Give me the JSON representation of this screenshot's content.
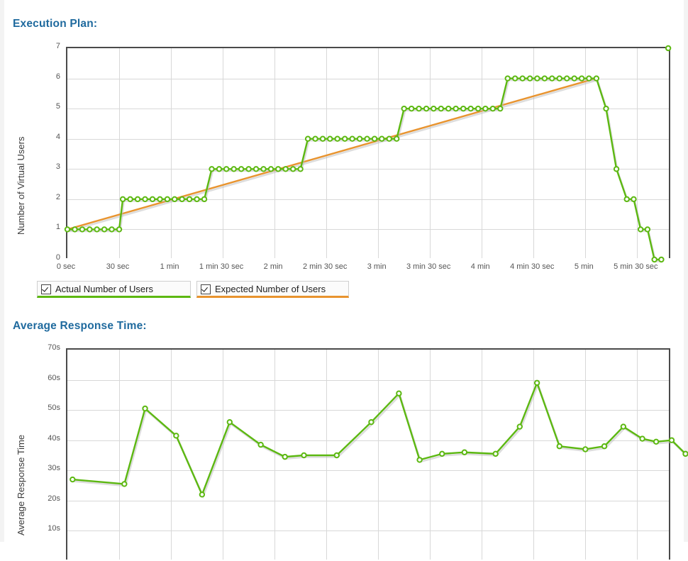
{
  "page": {
    "background": "#ffffff",
    "accent_title_color": "#1f6a9e",
    "series_green": "#5cb811",
    "series_orange": "#e8932e",
    "axis_color": "#4a4a4a",
    "grid_color": "#d8d8d8"
  },
  "execution_plan": {
    "title": "Execution Plan:",
    "legend": [
      {
        "label": "Actual Number of Users",
        "checked": true,
        "color": "#5cb811"
      },
      {
        "label": "Expected Number of Users",
        "checked": true,
        "color": "#e8932e"
      }
    ]
  },
  "average_response": {
    "title": "Average Response Time:"
  },
  "chart_data": [
    {
      "id": "execution-plan",
      "type": "line",
      "title": "Execution Plan:",
      "xlabel": "",
      "ylabel": "Number of Virtual Users",
      "ylim": [
        0,
        7
      ],
      "yticks": [
        0,
        1,
        2,
        3,
        4,
        5,
        6,
        7
      ],
      "ytick_labels": [
        "0",
        "1",
        "2",
        "3",
        "4",
        "5",
        "6",
        "7"
      ],
      "xlim_seconds": [
        0,
        350
      ],
      "xticks_seconds": [
        0,
        30,
        60,
        90,
        120,
        150,
        180,
        210,
        240,
        270,
        300,
        330
      ],
      "xtick_labels": [
        "0 sec",
        "30 sec",
        "1 min",
        "1 min 30 sec",
        "2 min",
        "2 min 30 sec",
        "3 min",
        "3 min 30 sec",
        "4 min",
        "4 min 30 sec",
        "5 min",
        "5 min 30 sec"
      ],
      "grid": true,
      "legend_position": "below",
      "markers": "open-circle",
      "series": [
        {
          "name": "Actual Number of Users",
          "color": "#5cb811",
          "x": [
            0,
            4.3,
            8.6,
            12.9,
            17.1,
            21.4,
            25.7,
            30,
            32.1,
            36.4,
            40.7,
            45,
            49.3,
            53.6,
            57.9,
            62.1,
            66.4,
            70.7,
            75,
            79.3,
            83.6,
            87.9,
            92.1,
            96.4,
            100.7,
            105,
            109.3,
            113.6,
            117.9,
            122.1,
            126.4,
            130.7,
            135,
            139.3,
            143.6,
            147.9,
            152.1,
            156.4,
            160.7,
            165,
            169.3,
            173.6,
            177.9,
            182.1,
            186.4,
            190.7,
            195,
            199.3,
            203.6,
            207.9,
            212.1,
            216.4,
            220.7,
            225,
            229.3,
            233.6,
            237.9,
            242.1,
            246.4,
            250.7,
            255,
            259.3,
            263.6,
            267.9,
            272.1,
            276.4,
            280.7,
            285,
            289.3,
            293.6,
            297.9,
            302.1,
            306.4,
            312,
            318,
            324,
            328,
            332,
            336,
            340,
            344,
            348
          ],
          "y": [
            1,
            1,
            1,
            1,
            1,
            1,
            1,
            1,
            2,
            2,
            2,
            2,
            2,
            2,
            2,
            2,
            2,
            2,
            2,
            2,
            3,
            3,
            3,
            3,
            3,
            3,
            3,
            3,
            3,
            3,
            3,
            3,
            3,
            4,
            4,
            4,
            4,
            4,
            4,
            4,
            4,
            4,
            4,
            4,
            4,
            4,
            5,
            5,
            5,
            5,
            5,
            5,
            5,
            5,
            5,
            5,
            5,
            5,
            5,
            5,
            6,
            6,
            6,
            6,
            6,
            6,
            6,
            6,
            6,
            6,
            6,
            6,
            6,
            5,
            3,
            2,
            2,
            1,
            1,
            0,
            0
          ]
        },
        {
          "name": "Expected Number of Users",
          "color": "#e8932e",
          "x": [
            0,
            306
          ],
          "y": [
            1,
            6
          ]
        }
      ]
    },
    {
      "id": "average-response-time",
      "type": "line",
      "title": "Average Response Time:",
      "xlabel": "",
      "ylabel": "Average Response Time",
      "ylim": [
        0,
        70
      ],
      "yticks": [
        10,
        20,
        30,
        40,
        50,
        60,
        70
      ],
      "ytick_labels": [
        "10s",
        "20s",
        "30s",
        "40s",
        "50s",
        "60s",
        "70s"
      ],
      "xlim_seconds": [
        0,
        350
      ],
      "xticks_seconds": [
        0,
        30,
        60,
        90,
        120,
        150,
        180,
        210,
        240,
        270,
        300,
        330
      ],
      "grid": true,
      "markers": "open-circle",
      "series": [
        {
          "name": "Average Response Time",
          "color": "#5cb811",
          "x": [
            3,
            33,
            45,
            63,
            78,
            94,
            112,
            126,
            137,
            156,
            176,
            192,
            204,
            217,
            230,
            248,
            262,
            272,
            285,
            300,
            311,
            322,
            333,
            341,
            350,
            358
          ],
          "y": [
            27,
            25.5,
            50.5,
            41.5,
            22,
            46,
            38.5,
            34.5,
            35,
            35,
            46,
            55.5,
            33.5,
            35.5,
            36,
            35.5,
            44.5,
            59,
            38,
            37,
            38,
            44.5,
            40.5,
            39.5,
            40,
            35.5
          ]
        }
      ]
    }
  ]
}
